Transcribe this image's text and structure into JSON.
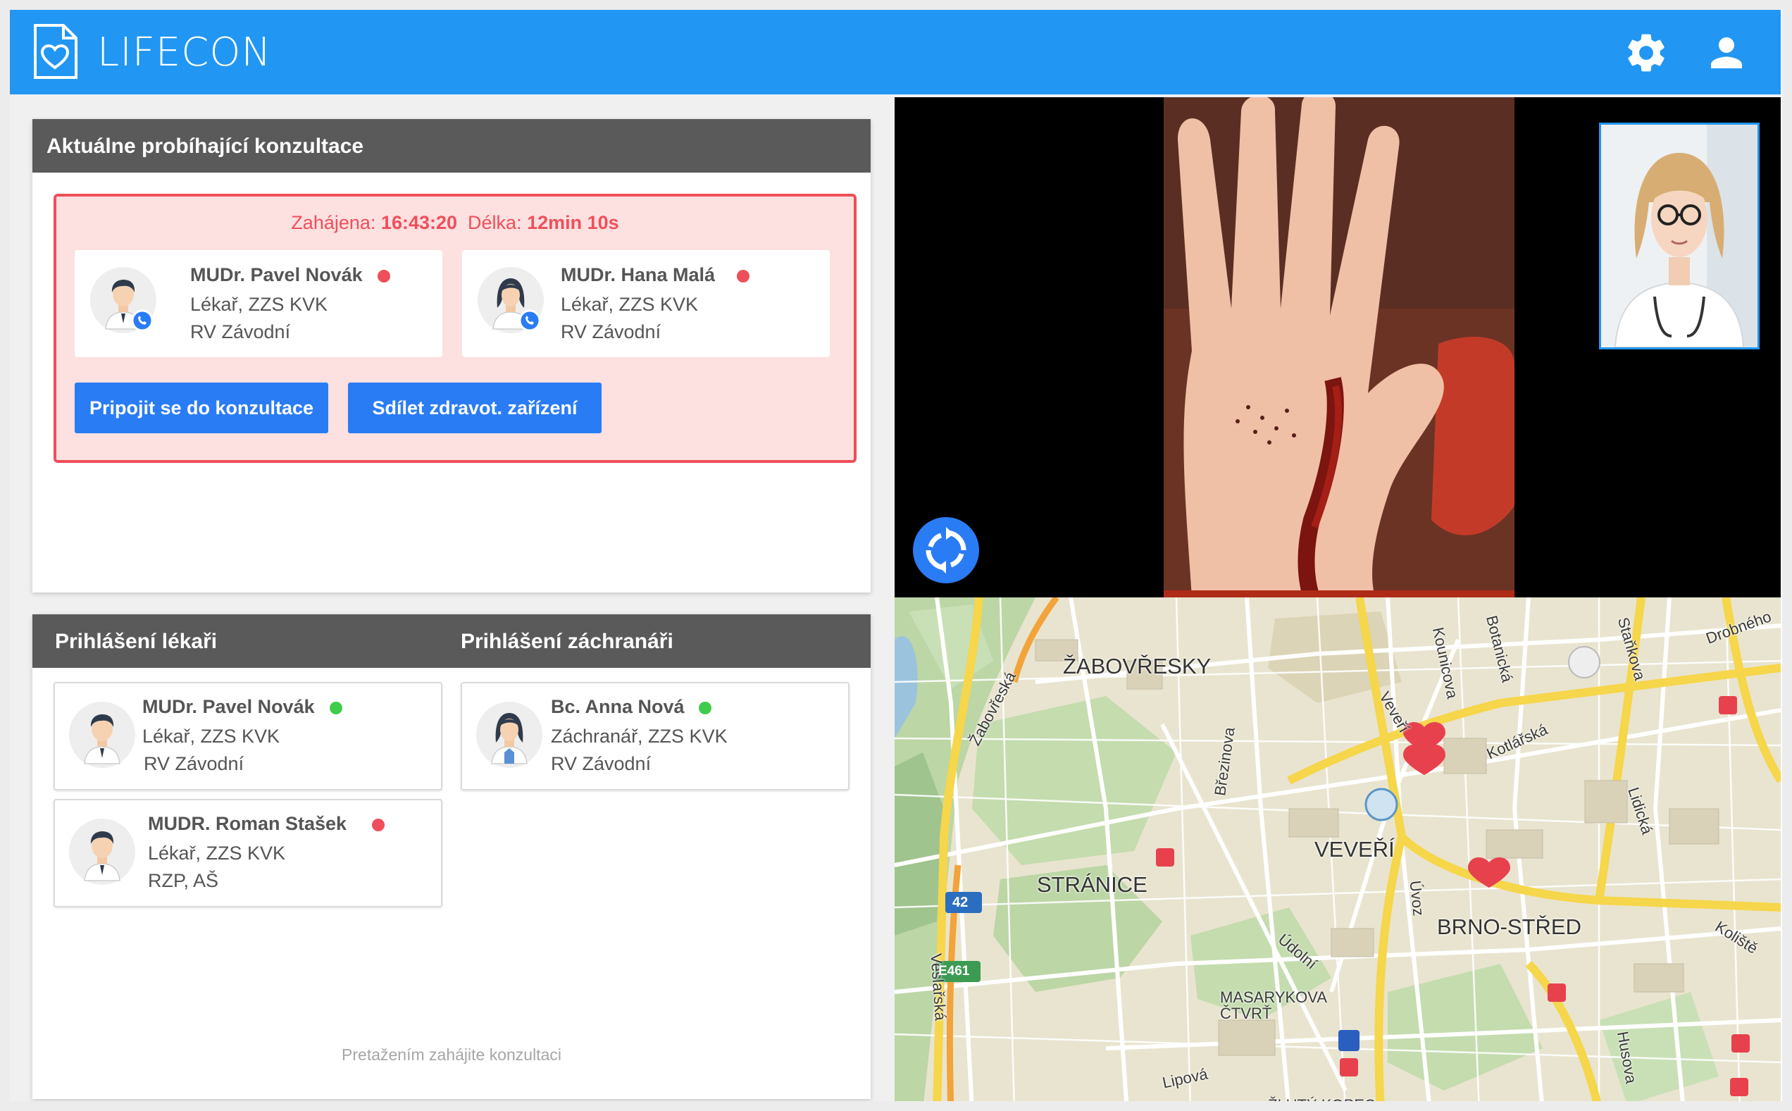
{
  "app": {
    "title": "LIFECON"
  },
  "header": {
    "settings_icon": "gear-icon",
    "user_icon": "user-icon"
  },
  "colors": {
    "topbar": "#2196f3",
    "accent_button": "#2a7cf5",
    "alert_red": "#ef4f5a",
    "online_green": "#3ecc4a",
    "card_header": "#5a5a5a"
  },
  "consultation": {
    "panel_title": "Aktuálne probíhající konzultace",
    "started_label": "Zahájena:",
    "started_value": "16:43:20",
    "duration_label": "Délka:",
    "duration_value": "12min 10s",
    "participants": [
      {
        "name": "MUDr. Pavel Novák",
        "role": "Lékař, ZZS KVK",
        "location": "RV Závodní",
        "status": "busy"
      },
      {
        "name": "MUDr. Hana Malá",
        "role": "Lékař, ZZS KVK",
        "location": "RV Závodní",
        "status": "busy"
      }
    ],
    "join_button": "Pripojit se do konzultace",
    "share_button": "Sdílet zdravot. zařízení"
  },
  "logged_in": {
    "doctors_title": "Prihlášení lékaři",
    "rescuers_title": "Prihlášení záchranáři",
    "doctors": [
      {
        "name": "MUDr. Pavel Novák",
        "role": "Lékař, ZZS KVK",
        "location": "RV Závodní",
        "status": "online"
      },
      {
        "name": "MUDR. Roman Stašek",
        "role": "Lékař, ZZS KVK",
        "location": "RZP, AŠ",
        "status": "busy"
      }
    ],
    "rescuers": [
      {
        "name": "Bc. Anna Nová",
        "role": "Záchranář, ZZS KVK",
        "location": "RV Závodní",
        "status": "online"
      }
    ],
    "hint": "Pretažením zahájite konzultaci"
  },
  "video": {
    "rotate_icon": "rotate-camera-icon"
  },
  "map": {
    "districts": [
      "ŽABOVŘESKY",
      "VEVEŘÍ",
      "STRÁNICE",
      "BRNO-STŘED",
      "MASARYKOVA",
      "ČTVRŤ",
      "ŽLUTÝ KOPEC"
    ],
    "streets": [
      "Žabovřeská",
      "Březinova",
      "Veveří",
      "Kounicova",
      "Botanická",
      "Kotlářská",
      "Lidická",
      "Úvoz",
      "Údolní",
      "Husova",
      "Lipová",
      "Veslařská",
      "Drobného",
      "Koliště",
      "Staňkova"
    ],
    "road_shields": [
      "42",
      "E461"
    ]
  }
}
